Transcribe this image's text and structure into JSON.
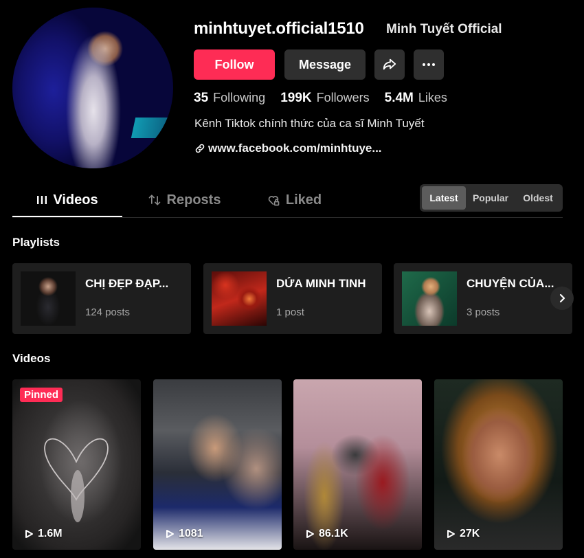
{
  "profile": {
    "handle": "minhtuyet.official1510",
    "nickname": "Minh Tuyết Official",
    "follow_label": "Follow",
    "message_label": "Message",
    "stats": [
      {
        "value": "35",
        "label": "Following"
      },
      {
        "value": "199K",
        "label": "Followers"
      },
      {
        "value": "5.4M",
        "label": "Likes"
      }
    ],
    "bio": "Kênh Tiktok chính thức của ca sĩ Minh Tuyết",
    "link": "www.facebook.com/minhtuye..."
  },
  "tabs": [
    {
      "label": "Videos",
      "icon": "grid-icon",
      "active": true
    },
    {
      "label": "Reposts",
      "icon": "repost-icon",
      "active": false
    },
    {
      "label": "Liked",
      "icon": "heart-lock-icon",
      "active": false
    }
  ],
  "sort": {
    "options": [
      "Latest",
      "Popular",
      "Oldest"
    ],
    "selected": "Latest"
  },
  "playlists_title": "Playlists",
  "playlists": [
    {
      "name": "CHỊ ĐẸP ĐẠP...",
      "count": "124 posts"
    },
    {
      "name": "DỨA MINH TINH",
      "count": "1 post"
    },
    {
      "name": "CHUYỆN CỦA...",
      "count": "3 posts"
    }
  ],
  "videos_title": "Videos",
  "videos": [
    {
      "views": "1.6M",
      "pinned": "Pinned"
    },
    {
      "views": "1081"
    },
    {
      "views": "86.1K"
    },
    {
      "views": "27K"
    }
  ],
  "colors": {
    "accent": "#fe2c55",
    "button_bg": "#2f2f2f",
    "card_bg": "#1e1e1e"
  }
}
